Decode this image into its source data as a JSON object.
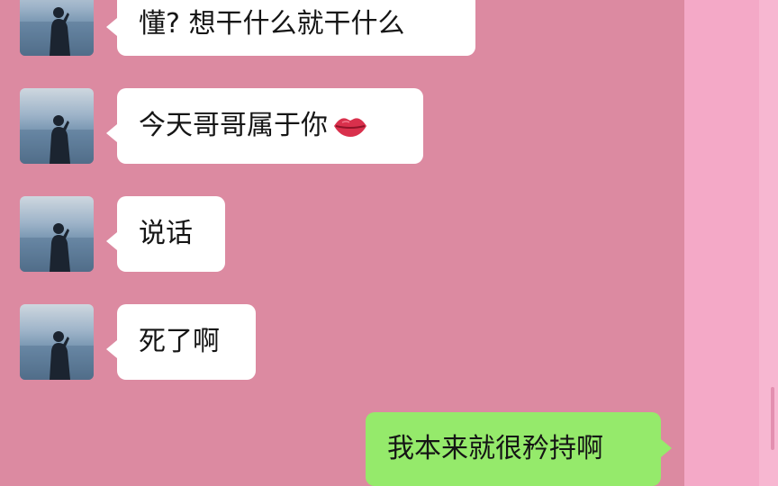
{
  "messages": [
    {
      "sender": "other",
      "text": "懂? 想干什么就干什么"
    },
    {
      "sender": "other",
      "text": "今天哥哥属于你",
      "emoji": "lips-icon"
    },
    {
      "sender": "other",
      "text": "说话"
    },
    {
      "sender": "other",
      "text": "死了啊"
    },
    {
      "sender": "self",
      "text": "我本来就很矜持啊"
    }
  ],
  "colors": {
    "chat_background": "#dc8aa1",
    "side_panel": "#f4a9c7",
    "incoming_bubble": "#ffffff",
    "outgoing_bubble": "#95ea6b"
  }
}
